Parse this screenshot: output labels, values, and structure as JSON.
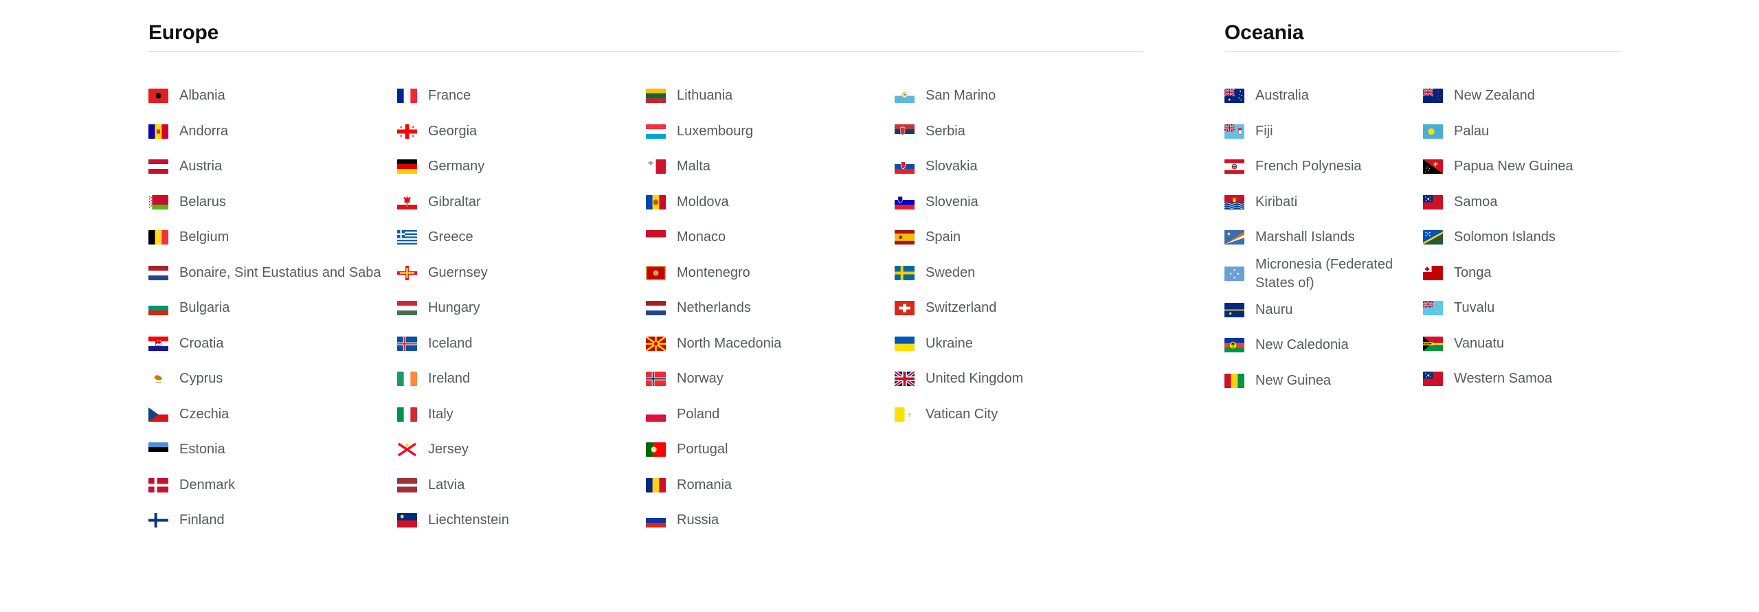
{
  "page": {
    "background": "#ffffff",
    "text_color": "#565a5e",
    "title_color": "#111111",
    "rule_color": "#e7e7e9"
  },
  "regions": [
    {
      "id": "europe",
      "title": "Europe",
      "columns": [
        {
          "items": [
            {
              "name": "Albania",
              "flag": "al"
            },
            {
              "name": "Andorra",
              "flag": "ad"
            },
            {
              "name": "Austria",
              "flag": "at"
            },
            {
              "name": "Belarus",
              "flag": "by"
            },
            {
              "name": "Belgium",
              "flag": "be"
            },
            {
              "name": "Bonaire, Sint Eustatius and Saba",
              "flag": "bq"
            },
            {
              "name": "Bulgaria",
              "flag": "bg"
            },
            {
              "name": "Croatia",
              "flag": "hr"
            },
            {
              "name": "Cyprus",
              "flag": "cy"
            },
            {
              "name": "Czechia",
              "flag": "cz"
            },
            {
              "name": "Estonia",
              "flag": "ee"
            },
            {
              "name": "Denmark",
              "flag": "dk"
            },
            {
              "name": "Finland",
              "flag": "fi"
            }
          ]
        },
        {
          "items": [
            {
              "name": "France",
              "flag": "fr"
            },
            {
              "name": "Georgia",
              "flag": "ge"
            },
            {
              "name": "Germany",
              "flag": "de"
            },
            {
              "name": "Gibraltar",
              "flag": "gi"
            },
            {
              "name": "Greece",
              "flag": "gr"
            },
            {
              "name": "Guernsey",
              "flag": "gg"
            },
            {
              "name": "Hungary",
              "flag": "hu"
            },
            {
              "name": "Iceland",
              "flag": "is"
            },
            {
              "name": "Ireland",
              "flag": "ie"
            },
            {
              "name": "Italy",
              "flag": "it"
            },
            {
              "name": "Jersey",
              "flag": "je"
            },
            {
              "name": "Latvia",
              "flag": "lv"
            },
            {
              "name": "Liechtenstein",
              "flag": "li"
            }
          ]
        },
        {
          "items": [
            {
              "name": "Lithuania",
              "flag": "lt"
            },
            {
              "name": "Luxembourg",
              "flag": "lu"
            },
            {
              "name": "Malta",
              "flag": "mt"
            },
            {
              "name": "Moldova",
              "flag": "md"
            },
            {
              "name": "Monaco",
              "flag": "mc"
            },
            {
              "name": "Montenegro",
              "flag": "me"
            },
            {
              "name": "Netherlands",
              "flag": "nl"
            },
            {
              "name": "North Macedonia",
              "flag": "mk"
            },
            {
              "name": "Norway",
              "flag": "no"
            },
            {
              "name": "Poland",
              "flag": "pl"
            },
            {
              "name": "Portugal",
              "flag": "pt"
            },
            {
              "name": "Romania",
              "flag": "ro"
            },
            {
              "name": "Russia",
              "flag": "ru"
            }
          ]
        },
        {
          "items": [
            {
              "name": "San Marino",
              "flag": "sm"
            },
            {
              "name": "Serbia",
              "flag": "rs"
            },
            {
              "name": "Slovakia",
              "flag": "sk"
            },
            {
              "name": "Slovenia",
              "flag": "si"
            },
            {
              "name": "Spain",
              "flag": "es"
            },
            {
              "name": "Sweden",
              "flag": "se"
            },
            {
              "name": "Switzerland",
              "flag": "ch"
            },
            {
              "name": "Ukraine",
              "flag": "ua"
            },
            {
              "name": "United Kingdom",
              "flag": "gb"
            },
            {
              "name": "Vatican City",
              "flag": "va"
            }
          ]
        }
      ]
    },
    {
      "id": "oceania",
      "title": "Oceania",
      "columns": [
        {
          "items": [
            {
              "name": "Australia",
              "flag": "au"
            },
            {
              "name": "Fiji",
              "flag": "fj"
            },
            {
              "name": "French Polynesia",
              "flag": "pf"
            },
            {
              "name": "Kiribati",
              "flag": "ki"
            },
            {
              "name": "Marshall Islands",
              "flag": "mh"
            },
            {
              "name": "Micronesia (Federated States of)",
              "flag": "fm"
            },
            {
              "name": "Nauru",
              "flag": "nr"
            },
            {
              "name": "New Caledonia",
              "flag": "nc"
            },
            {
              "name": "New Guinea",
              "flag": "ng"
            }
          ]
        },
        {
          "items": [
            {
              "name": "New Zealand",
              "flag": "nz"
            },
            {
              "name": "Palau",
              "flag": "pw"
            },
            {
              "name": "Papua New Guinea",
              "flag": "pg"
            },
            {
              "name": "Samoa",
              "flag": "ws"
            },
            {
              "name": "Solomon Islands",
              "flag": "sb"
            },
            {
              "name": "Tonga",
              "flag": "to"
            },
            {
              "name": "Tuvalu",
              "flag": "tv"
            },
            {
              "name": "Vanuatu",
              "flag": "vu"
            },
            {
              "name": "Western Samoa",
              "flag": "ws2"
            }
          ]
        }
      ]
    }
  ]
}
